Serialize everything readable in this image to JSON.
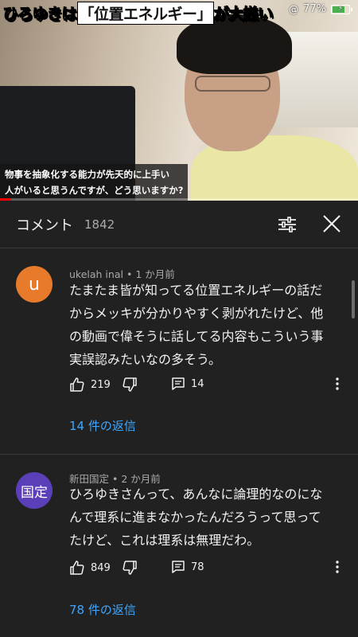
{
  "status_bar": {
    "battery_text": "77%",
    "battery_level": 0.77
  },
  "video": {
    "title_parts": [
      "ひろゆきは",
      "「位置エネルギー」",
      "が大嫌い"
    ],
    "caption_line1": "物事を抽象化する能力が先天的に上手い",
    "caption_line2": "人がいると思うんですが、どう思いますか?",
    "progress": 0.03
  },
  "comments_header": {
    "title": "コメント",
    "count": "1842"
  },
  "comments": [
    {
      "avatar_text": "u",
      "avatar_color": "#e87a2b",
      "author": "ukelah inal",
      "time": "1 か月前",
      "lines": [
        "たまたま皆が知ってる位置エネルギーの話だ",
        "からメッキが分かりやすく剥がれたけど、他",
        "の動画で偉そうに話してる内容もこういう事",
        "実誤認みたいなの多そう。"
      ],
      "likes": "219",
      "replies_count": "14",
      "replies_label": "14 件の返信"
    },
    {
      "avatar_text": "国定",
      "avatar_color": "#5b3fb8",
      "author": "新田国定",
      "time": "2 か月前",
      "lines": [
        "ひろゆきさんって、あんなに論理的なのにな",
        "んで理系に進まなかったんだろうって思って",
        "たけど、これは理系は無理だわ。"
      ],
      "likes": "849",
      "replies_count": "78",
      "replies_label": "78 件の返信"
    }
  ],
  "colors": {
    "background": "#212121",
    "link": "#3ea6ff",
    "muted": "#aaaaaa"
  }
}
